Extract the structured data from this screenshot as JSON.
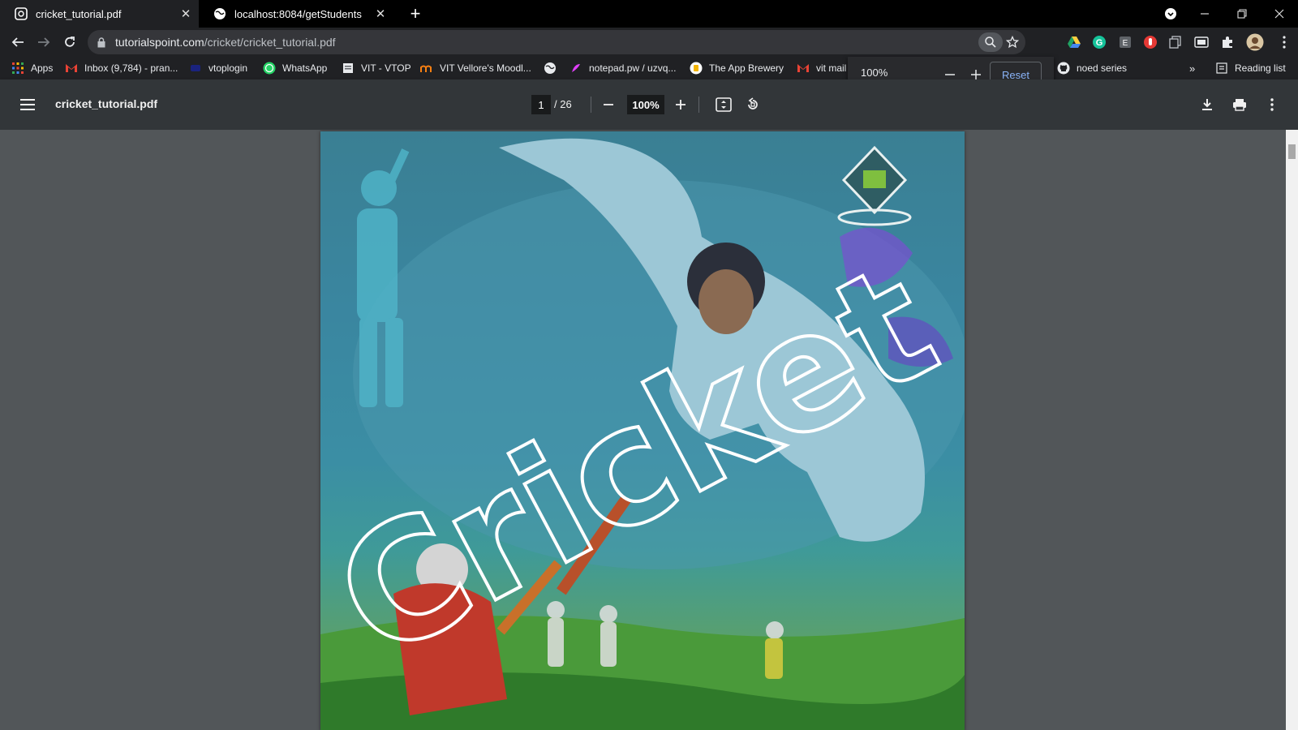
{
  "tabs": [
    {
      "title": "cricket_tutorial.pdf",
      "active": true
    },
    {
      "title": "localhost:8084/getStudents",
      "active": false
    }
  ],
  "address": {
    "host": "tutorialspoint.com",
    "path": "/cricket/cricket_tutorial.pdf"
  },
  "bookmarks": [
    {
      "label": "Apps",
      "icon": "apps-grid-icon"
    },
    {
      "label": "Inbox (9,784) - pran...",
      "icon": "gmail-icon"
    },
    {
      "label": "vtoplogin",
      "icon": "vtop-icon"
    },
    {
      "label": "WhatsApp",
      "icon": "whatsapp-icon"
    },
    {
      "label": "VIT - VTOP",
      "icon": "page-icon"
    },
    {
      "label": "VIT Vellore's Moodl...",
      "icon": "moodle-icon"
    },
    {
      "label": "",
      "icon": "globe-icon"
    },
    {
      "label": "notepad.pw / uzvq...",
      "icon": "notepad-icon"
    },
    {
      "label": "The App Brewery",
      "icon": "brewery-icon"
    },
    {
      "label": "vit mail",
      "icon": "gmail-icon"
    },
    {
      "label": "noed series",
      "icon": "github-icon"
    }
  ],
  "reading_list": "Reading list",
  "zoom_popup": {
    "value": "100%",
    "reset": "Reset"
  },
  "pdf": {
    "title": "cricket_tutorial.pdf",
    "page": "1",
    "total": "/ 26",
    "zoom": "100%",
    "cover_text": "Cricket"
  },
  "colors": {
    "accent": "#8ab4f8",
    "tab_bg": "#202124",
    "toolbar_bg": "#323639",
    "viewer_bg": "#525659"
  }
}
